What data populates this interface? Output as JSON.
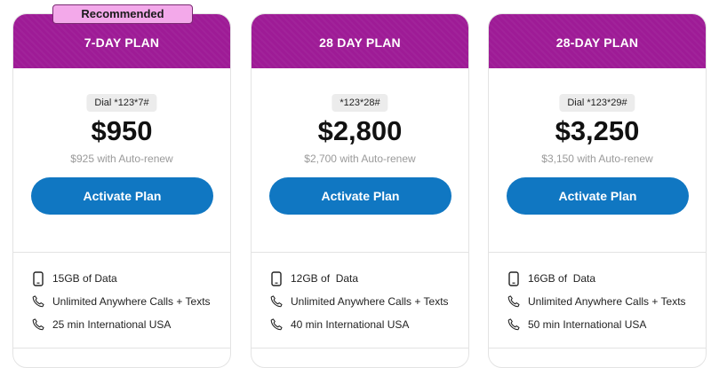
{
  "badge": {
    "label": "Recommended"
  },
  "plans": [
    {
      "name": "7-DAY PLAN",
      "dial": "Dial *123*7#",
      "price": "$950",
      "auto_renew": "$925 with Auto-renew",
      "button": "Activate Plan",
      "features": [
        {
          "icon": "phone-icon",
          "text": "15GB of Data"
        },
        {
          "icon": "call-icon",
          "text": "Unlimited Anywhere Calls + Texts"
        },
        {
          "icon": "call-icon",
          "text": "25 min International USA"
        }
      ]
    },
    {
      "name": "28 DAY PLAN",
      "dial": "*123*28#",
      "price": "$2,800",
      "auto_renew": "$2,700 with Auto-renew",
      "button": "Activate Plan",
      "features": [
        {
          "icon": "phone-icon",
          "text": "12GB of  Data"
        },
        {
          "icon": "call-icon",
          "text": "Unlimited Anywhere Calls + Texts"
        },
        {
          "icon": "call-icon",
          "text": "40 min International USA"
        }
      ]
    },
    {
      "name": "28-DAY PLAN",
      "dial": "Dial *123*29#",
      "price": "$3,250",
      "auto_renew": "$3,150 with Auto-renew",
      "button": "Activate Plan",
      "features": [
        {
          "icon": "phone-icon",
          "text": "16GB of  Data"
        },
        {
          "icon": "call-icon",
          "text": "Unlimited Anywhere Calls + Texts"
        },
        {
          "icon": "call-icon",
          "text": "50 min International USA"
        }
      ]
    }
  ],
  "colors": {
    "header": "#9e1b96",
    "button": "#1077c2",
    "badge": "#f3a9ea"
  }
}
